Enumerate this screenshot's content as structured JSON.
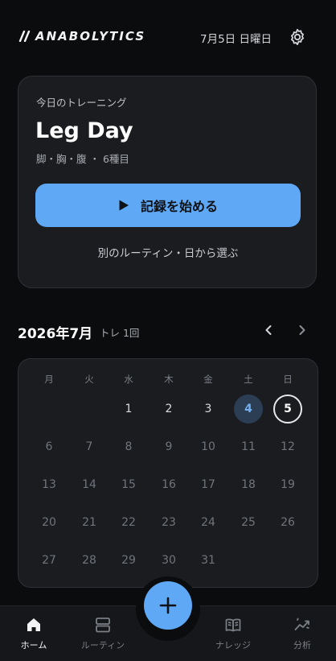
{
  "header": {
    "brand": "ANABOLYTICS",
    "date": "7月5日 日曜日",
    "settings_icon": "gear-icon"
  },
  "today_card": {
    "label": "今日のトレーニング",
    "title": "Leg Day",
    "subtitle": "脚・胸・腹 ・ 6種目",
    "start_label": "記録を始める",
    "alt_link": "別のルーティン・日から選ぶ"
  },
  "calendar": {
    "month_title": "2026年7月",
    "training_count": "トレ 1回",
    "weekdays": [
      "月",
      "火",
      "水",
      "木",
      "金",
      "土",
      "日"
    ],
    "leading_blanks": 2,
    "days": [
      "1",
      "2",
      "3",
      "4",
      "5",
      "6",
      "7",
      "8",
      "9",
      "10",
      "11",
      "12",
      "13",
      "14",
      "15",
      "16",
      "17",
      "18",
      "19",
      "20",
      "21",
      "22",
      "23",
      "24",
      "25",
      "26",
      "27",
      "28",
      "29",
      "30",
      "31"
    ],
    "trained_day": "4",
    "today": "5",
    "colors": {
      "accent": "#5ea8f6",
      "trained_bg": "#2c3e54"
    }
  },
  "tabs": [
    {
      "label": "ホーム",
      "icon": "home-icon",
      "active": true
    },
    {
      "label": "ルーティン",
      "icon": "routine-icon",
      "active": false
    },
    {
      "label": "ナレッジ",
      "icon": "book-icon",
      "active": false
    },
    {
      "label": "分析",
      "icon": "analytics-icon",
      "active": false
    }
  ],
  "fab": {
    "icon": "plus-icon"
  }
}
